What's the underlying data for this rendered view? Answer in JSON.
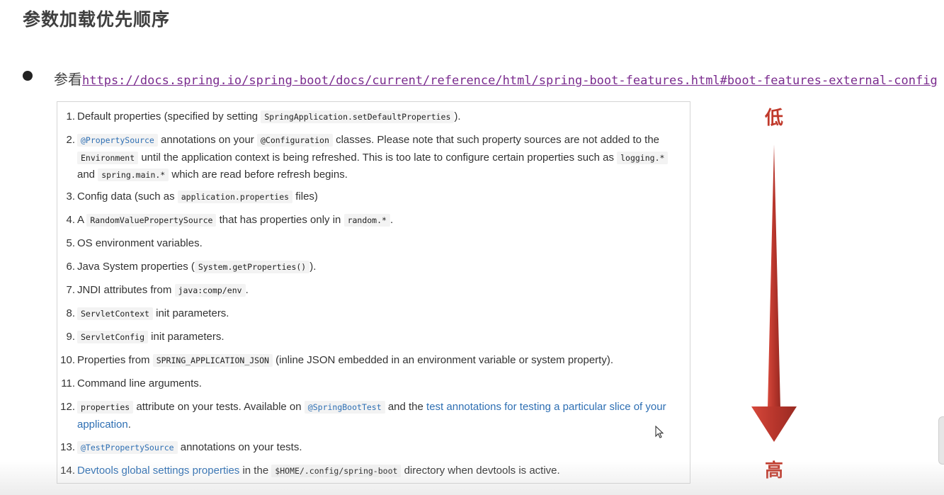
{
  "slide": {
    "title": "参数加载优先顺序",
    "ref_prefix": "参看",
    "ref_url": "https://docs.spring.io/spring-boot/docs/current/reference/html/spring-boot-features.html#boot-features-external-config"
  },
  "priority": {
    "low_label": "低",
    "high_label": "高",
    "arrow_color": "#c0392b"
  },
  "items": [
    {
      "num": "1.",
      "parts": [
        {
          "t": "text",
          "v": "Default properties (specified by setting "
        },
        {
          "t": "code",
          "v": "SpringApplication.setDefaultProperties"
        },
        {
          "t": "text",
          "v": ")."
        }
      ]
    },
    {
      "num": "2.",
      "parts": [
        {
          "t": "codelink",
          "v": "@PropertySource"
        },
        {
          "t": "text",
          "v": " annotations on your "
        },
        {
          "t": "code",
          "v": "@Configuration"
        },
        {
          "t": "text",
          "v": " classes. Please note that such property sources are not added to the "
        },
        {
          "t": "code",
          "v": "Environment"
        },
        {
          "t": "text",
          "v": " until the application context is being refreshed. This is too late to configure certain properties such as "
        },
        {
          "t": "code",
          "v": "logging.*"
        },
        {
          "t": "text",
          "v": " and "
        },
        {
          "t": "code",
          "v": "spring.main.*"
        },
        {
          "t": "text",
          "v": " which are read before refresh begins."
        }
      ]
    },
    {
      "num": "3.",
      "parts": [
        {
          "t": "text",
          "v": "Config data (such as "
        },
        {
          "t": "code",
          "v": "application.properties"
        },
        {
          "t": "text",
          "v": " files)"
        }
      ]
    },
    {
      "num": "4.",
      "parts": [
        {
          "t": "text",
          "v": "A "
        },
        {
          "t": "code",
          "v": "RandomValuePropertySource"
        },
        {
          "t": "text",
          "v": " that has properties only in "
        },
        {
          "t": "code",
          "v": "random.*"
        },
        {
          "t": "text",
          "v": "."
        }
      ]
    },
    {
      "num": "5.",
      "parts": [
        {
          "t": "text",
          "v": "OS environment variables."
        }
      ]
    },
    {
      "num": "6.",
      "parts": [
        {
          "t": "text",
          "v": "Java System properties ("
        },
        {
          "t": "code",
          "v": "System.getProperties()"
        },
        {
          "t": "text",
          "v": ")."
        }
      ]
    },
    {
      "num": "7.",
      "parts": [
        {
          "t": "text",
          "v": "JNDI attributes from "
        },
        {
          "t": "code",
          "v": "java:comp/env"
        },
        {
          "t": "text",
          "v": "."
        }
      ]
    },
    {
      "num": "8.",
      "parts": [
        {
          "t": "code",
          "v": "ServletContext"
        },
        {
          "t": "text",
          "v": " init parameters."
        }
      ]
    },
    {
      "num": "9.",
      "parts": [
        {
          "t": "code",
          "v": "ServletConfig"
        },
        {
          "t": "text",
          "v": " init parameters."
        }
      ]
    },
    {
      "num": "10.",
      "parts": [
        {
          "t": "text",
          "v": "Properties from "
        },
        {
          "t": "code",
          "v": "SPRING_APPLICATION_JSON"
        },
        {
          "t": "text",
          "v": " (inline JSON embedded in an environment variable or system property)."
        }
      ]
    },
    {
      "num": "11.",
      "parts": [
        {
          "t": "text",
          "v": "Command line arguments."
        }
      ]
    },
    {
      "num": "12.",
      "parts": [
        {
          "t": "code",
          "v": "properties"
        },
        {
          "t": "text",
          "v": " attribute on your tests. Available on "
        },
        {
          "t": "codelink",
          "v": "@SpringBootTest"
        },
        {
          "t": "text",
          "v": " and the "
        },
        {
          "t": "link",
          "v": "test annotations for testing a particular slice of your application"
        },
        {
          "t": "text",
          "v": "."
        }
      ]
    },
    {
      "num": "13.",
      "parts": [
        {
          "t": "codelink",
          "v": "@TestPropertySource"
        },
        {
          "t": "text",
          "v": " annotations on your tests."
        }
      ]
    },
    {
      "num": "14.",
      "parts": [
        {
          "t": "link",
          "v": "Devtools global settings properties"
        },
        {
          "t": "text",
          "v": " in the "
        },
        {
          "t": "code",
          "v": "$HOME/.config/spring-boot"
        },
        {
          "t": "text",
          "v": " directory when devtools is active."
        }
      ]
    }
  ]
}
